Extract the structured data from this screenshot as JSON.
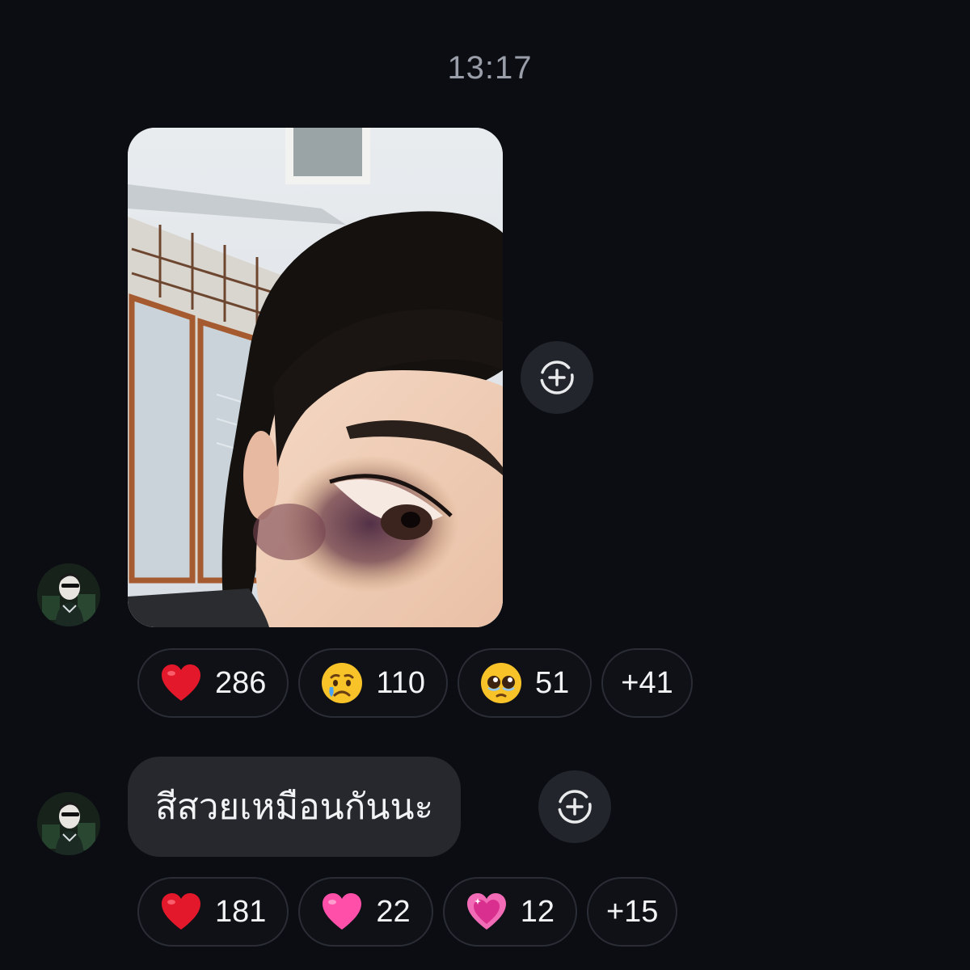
{
  "timestamp": "13:17",
  "messages": [
    {
      "type": "image",
      "reactions": [
        {
          "emoji": "red-heart",
          "count": "286"
        },
        {
          "emoji": "crying-face",
          "count": "110"
        },
        {
          "emoji": "pleading-face",
          "count": "51"
        }
      ],
      "more_reactions": "+41"
    },
    {
      "type": "text",
      "text": "สีสวยเหมือนกันนะ",
      "reactions": [
        {
          "emoji": "red-heart",
          "count": "181"
        },
        {
          "emoji": "pink-heart",
          "count": "22"
        },
        {
          "emoji": "sparkling-heart",
          "count": "12"
        }
      ],
      "more_reactions": "+15"
    }
  ],
  "colors": {
    "background": "#0b0d13",
    "bubble": "#26282e",
    "pill_border": "#2a2d35",
    "red_heart": "#e3182b",
    "pink_heart": "#ff4fa8"
  }
}
